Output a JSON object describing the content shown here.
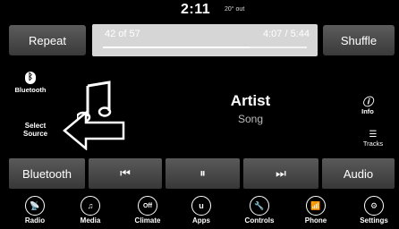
{
  "status": {
    "time": "2:11",
    "temperature": "20° out"
  },
  "top_bar": {
    "repeat_label": "Repeat",
    "shuffle_label": "Shuffle",
    "track_count": "42 of 57",
    "track_time": "4:07 / 5:44",
    "progress": 0.72
  },
  "source": {
    "bluetooth_label": "Bluetooth",
    "select_source_line1": "Select",
    "select_source_line2": "Source"
  },
  "now_playing": {
    "artist": "Artist",
    "song": "Song"
  },
  "side": {
    "info_label": "Info",
    "tracks_label": "Tracks"
  },
  "controls": {
    "bluetooth_label": "Bluetooth",
    "prev_glyph": "⏮",
    "pause_glyph": "⏸",
    "next_glyph": "⏭",
    "audio_label": "Audio"
  },
  "nav": [
    {
      "label": "Radio",
      "glyph": "📡",
      "icon": "radio-icon"
    },
    {
      "label": "Media",
      "glyph": "♫",
      "icon": "media-icon"
    },
    {
      "label": "Climate",
      "glyph": "Off",
      "icon": "climate-icon"
    },
    {
      "label": "Apps",
      "glyph": "u",
      "icon": "apps-icon"
    },
    {
      "label": "Controls",
      "glyph": "🔧",
      "icon": "controls-icon"
    },
    {
      "label": "Phone",
      "glyph": "📶",
      "icon": "phone-icon"
    },
    {
      "label": "Settings",
      "glyph": "⚙",
      "icon": "settings-icon"
    }
  ]
}
